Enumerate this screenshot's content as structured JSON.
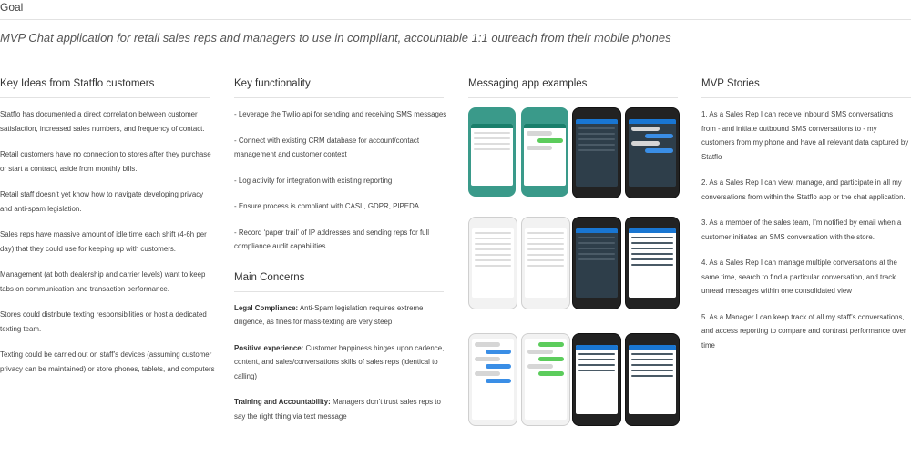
{
  "goal": {
    "label": "Goal",
    "text": "MVP Chat application for retail sales reps and managers to use in compliant, accountable 1:1 outreach from their mobile phones"
  },
  "key_ideas": {
    "heading": "Key Ideas from Statflo customers",
    "items": [
      "Statflo has documented a direct correlation between customer satisfaction, increased sales numbers, and frequency of contact.",
      "Retail customers have no connection to stores after they purchase or start a contract, aside from monthly bills.",
      "Retail staff doesn’t yet know how to navigate developing privacy and anti-spam legislation.",
      "Sales reps have massive amount of idle time each shift (4-6h per day) that they could use for keeping up with customers.",
      "Management (at both dealership and carrier levels) want to keep tabs on communication and transaction performance.",
      "Stores could distribute texting responsibilities or host a dedicated texting team.",
      "Texting could be carried out on staff’s devices (assuming customer privacy can be maintained) or store phones, tablets, and computers"
    ]
  },
  "key_functionality": {
    "heading": "Key functionality",
    "items": [
      "- Leverage the Twilio api for sending and receiving SMS messages",
      "- Connect with existing CRM database for account/contact management and customer context",
      "- Log activity for integration with existing reporting",
      "- Ensure process is compliant with CASL, GDPR, PIPEDA",
      "- Record ‘paper trail’ of IP addresses and sending reps for full compliance audit capabilities"
    ]
  },
  "main_concerns": {
    "heading": "Main Concerns",
    "items": [
      {
        "title": "Legal Compliance:",
        "text": " Anti-Spam legislation requires extreme diligence, as fines for mass-texting are very steep"
      },
      {
        "title": "Positive experience:",
        "text": " Customer happiness hinges upon cadence, content, and sales/conversations skills of sales reps (identical to calling)"
      },
      {
        "title": "Training and Accountability:",
        "text": " Managers don’t trust sales reps to say the right thing via text message"
      }
    ]
  },
  "messaging_examples": {
    "heading": "Messaging app examples"
  },
  "mvp_stories": {
    "heading": "MVP Stories",
    "items": [
      "1. As a Sales Rep I can receive inbound SMS conversations from  - and initiate outbound SMS conversations to - my customers from my phone and have all relevant data captured by Statflo",
      "2. As a Sales Rep I can view, manage, and participate in all my conversations from within the Statflo app or the chat application.",
      "3. As a member of the sales team, I’m notified by email when a customer initiates an SMS conversation with the store.",
      "4. As a Sales Rep I can manage multiple conversations at the same time, search to find a particular conversation, and track unread messages within one consolidated view",
      "5. As a Manager I can keep track of all my staff’s conversations, and access reporting to compare and contrast performance over time"
    ]
  }
}
